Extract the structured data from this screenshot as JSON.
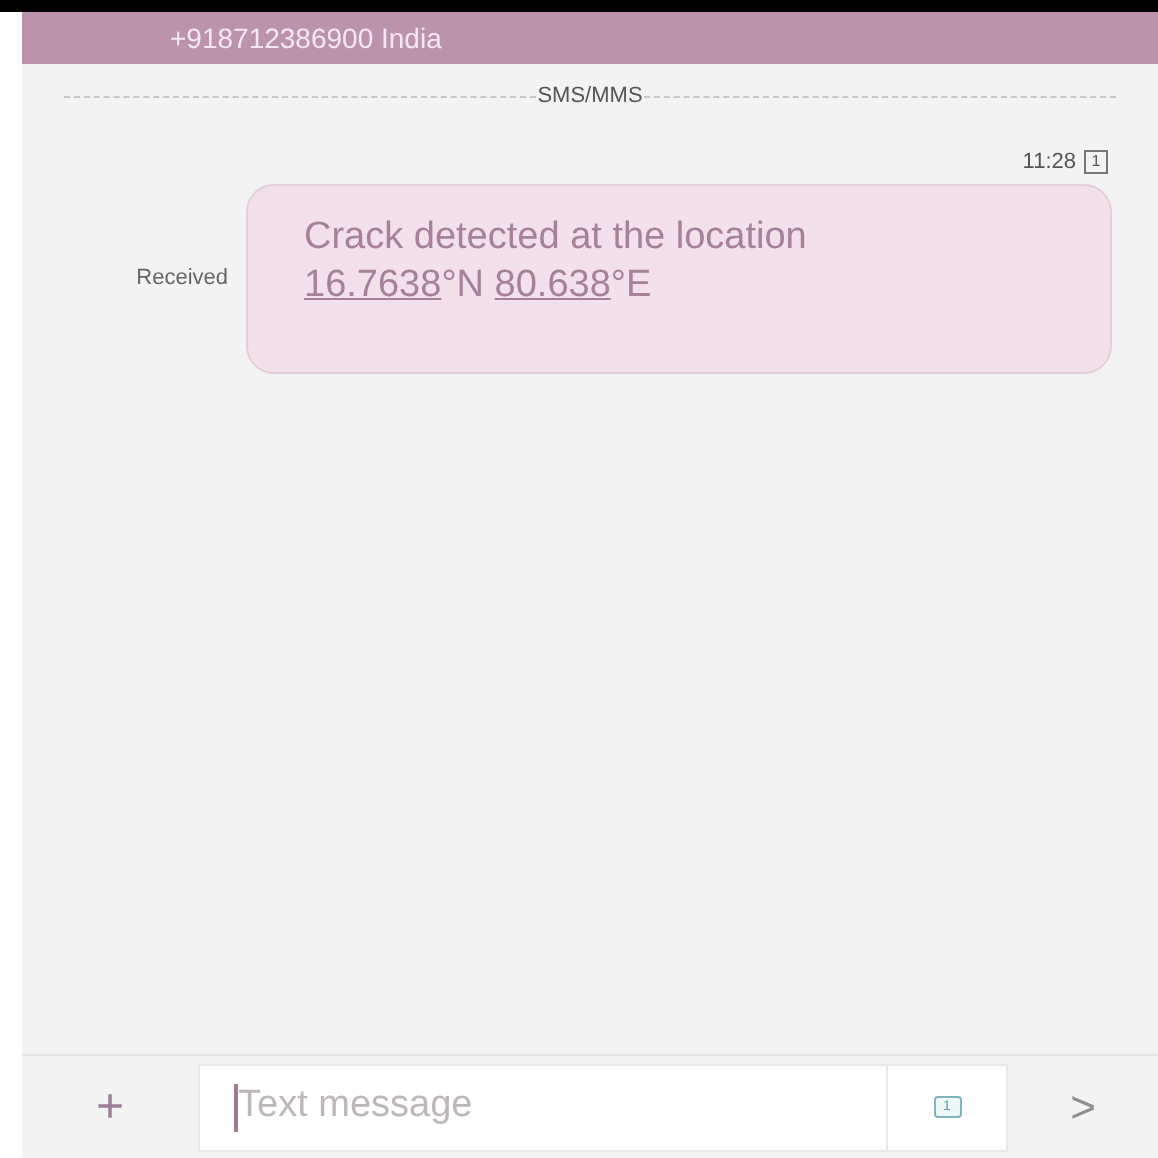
{
  "header": {
    "title": "+918712386900 India"
  },
  "divider_label": "SMS/MMS",
  "message": {
    "time": "11:28",
    "sim": "1",
    "status": "Received",
    "parts": [
      {
        "kind": "plain",
        "text": "Crack detected at the location "
      },
      {
        "kind": "link",
        "text": "16.7638"
      },
      {
        "kind": "plain",
        "text": "°N "
      },
      {
        "kind": "link",
        "text": "80.638"
      },
      {
        "kind": "plain",
        "text": "°E"
      }
    ]
  },
  "composer": {
    "add": "+",
    "placeholder": "Text message",
    "sim": "1",
    "send": ">"
  }
}
